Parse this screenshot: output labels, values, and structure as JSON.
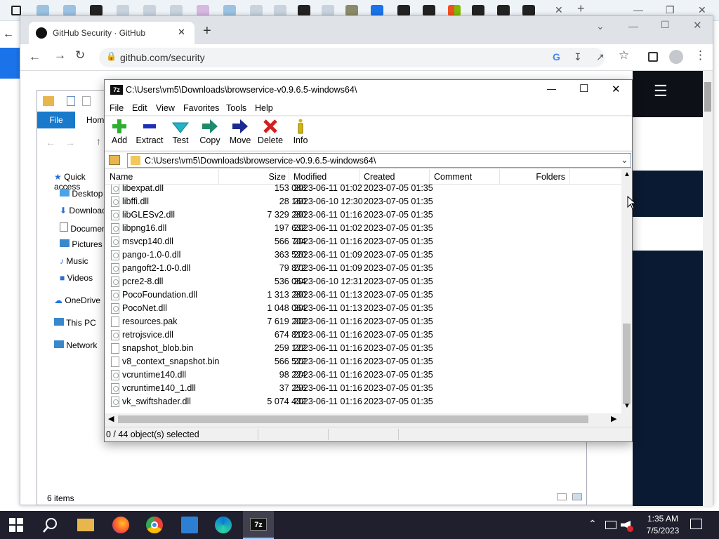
{
  "outer_window": {
    "minimize_glyph": "—",
    "maximize_glyph": "❐",
    "close_glyph": "✕",
    "new_tab_glyph": "+"
  },
  "chrome": {
    "tab_title": "GitHub Security · GitHub",
    "tab_close_glyph": "✕",
    "new_tab_glyph": "+",
    "url": "github.com/security",
    "menu_glyph": "⋮",
    "hamburger_glyph": "☰",
    "colors": {
      "site_dark": "#0b1a33"
    }
  },
  "explorer": {
    "file_tab": "File",
    "home_tab": "Home",
    "nav_items": [
      {
        "label": "Quick access",
        "icon": "star-icon"
      },
      {
        "label": "Desktop",
        "icon": "desktop-folder-icon"
      },
      {
        "label": "Downloads",
        "icon": "downloads-folder-icon"
      },
      {
        "label": "Documents",
        "icon": "documents-folder-icon"
      },
      {
        "label": "Pictures",
        "icon": "pictures-folder-icon"
      },
      {
        "label": "Music",
        "icon": "music-folder-icon"
      },
      {
        "label": "Videos",
        "icon": "videos-folder-icon"
      },
      {
        "label": "OneDrive",
        "icon": "onedrive-icon"
      },
      {
        "label": "This PC",
        "icon": "this-pc-icon"
      },
      {
        "label": "Network",
        "icon": "network-icon"
      }
    ],
    "status": "6 items"
  },
  "zip": {
    "app_icon_label": "7z",
    "title": "C:\\Users\\vm5\\Downloads\\browservice-v0.9.6.5-windows64\\",
    "minimize_glyph": "—",
    "maximize_glyph": "☐",
    "close_glyph": "✕",
    "menu": [
      "File",
      "Edit",
      "View",
      "Favorites",
      "Tools",
      "Help"
    ],
    "toolbar": [
      {
        "label": "Add",
        "icon": "add-plus-icon",
        "color": "#2fae2f"
      },
      {
        "label": "Extract",
        "icon": "extract-minus-icon",
        "color": "#1c2fb8"
      },
      {
        "label": "Test",
        "icon": "test-check-icon",
        "color": "#22b3c8"
      },
      {
        "label": "Copy",
        "icon": "copy-arrow-icon",
        "color": "#1f8a6c"
      },
      {
        "label": "Move",
        "icon": "move-arrow-icon",
        "color": "#1b2a8f"
      },
      {
        "label": "Delete",
        "icon": "delete-x-icon",
        "color": "#d41f1f"
      },
      {
        "label": "Info",
        "icon": "info-i-icon",
        "color": "#d4b400"
      }
    ],
    "address": "C:\\Users\\vm5\\Downloads\\browservice-v0.9.6.5-windows64\\",
    "columns": [
      "Name",
      "Size",
      "Modified",
      "Created",
      "Comment",
      "Folders"
    ],
    "rows": [
      {
        "name": "libexpat.dll",
        "size": "153 088",
        "modified": "2023-06-11 01:02",
        "created": "2023-07-05 01:35",
        "type": "dll"
      },
      {
        "name": "libffi.dll",
        "size": "28 160",
        "modified": "2023-06-10 12:30",
        "created": "2023-07-05 01:35",
        "type": "dll"
      },
      {
        "name": "libGLESv2.dll",
        "size": "7 329 280",
        "modified": "2023-06-11 01:16",
        "created": "2023-07-05 01:35",
        "type": "dll"
      },
      {
        "name": "libpng16.dll",
        "size": "197 632",
        "modified": "2023-06-11 01:02",
        "created": "2023-07-05 01:35",
        "type": "dll"
      },
      {
        "name": "msvcp140.dll",
        "size": "566 704",
        "modified": "2023-06-11 01:16",
        "created": "2023-07-05 01:35",
        "type": "dll"
      },
      {
        "name": "pango-1.0-0.dll",
        "size": "363 520",
        "modified": "2023-06-11 01:09",
        "created": "2023-07-05 01:35",
        "type": "dll"
      },
      {
        "name": "pangoft2-1.0-0.dll",
        "size": "79 872",
        "modified": "2023-06-11 01:09",
        "created": "2023-07-05 01:35",
        "type": "dll"
      },
      {
        "name": "pcre2-8.dll",
        "size": "536 064",
        "modified": "2023-06-10 12:31",
        "created": "2023-07-05 01:35",
        "type": "dll"
      },
      {
        "name": "PocoFoundation.dll",
        "size": "1 313 280",
        "modified": "2023-06-11 01:13",
        "created": "2023-07-05 01:35",
        "type": "dll"
      },
      {
        "name": "PocoNet.dll",
        "size": "1 048 064",
        "modified": "2023-06-11 01:13",
        "created": "2023-07-05 01:35",
        "type": "dll"
      },
      {
        "name": "resources.pak",
        "size": "7 619 202",
        "modified": "2023-06-11 01:16",
        "created": "2023-07-05 01:35",
        "type": "file"
      },
      {
        "name": "retrojsvice.dll",
        "size": "674 816",
        "modified": "2023-06-11 01:16",
        "created": "2023-07-05 01:35",
        "type": "dll"
      },
      {
        "name": "snapshot_blob.bin",
        "size": "259 122",
        "modified": "2023-06-11 01:16",
        "created": "2023-07-05 01:35",
        "type": "file"
      },
      {
        "name": "v8_context_snapshot.bin",
        "size": "566 522",
        "modified": "2023-06-11 01:16",
        "created": "2023-07-05 01:35",
        "type": "file"
      },
      {
        "name": "vcruntime140.dll",
        "size": "98 224",
        "modified": "2023-06-11 01:16",
        "created": "2023-07-05 01:35",
        "type": "dll"
      },
      {
        "name": "vcruntime140_1.dll",
        "size": "37 256",
        "modified": "2023-06-11 01:16",
        "created": "2023-07-05 01:35",
        "type": "dll"
      },
      {
        "name": "vk_swiftshader.dll",
        "size": "5 074 432",
        "modified": "2023-06-11 01:16",
        "created": "2023-07-05 01:35",
        "type": "dll"
      }
    ],
    "status": "0 / 44 object(s) selected"
  },
  "taskbar": {
    "time": "1:35 AM",
    "date": "7/5/2023",
    "apps": [
      "start-icon",
      "search-icon",
      "file-explorer-icon",
      "firefox-icon",
      "chrome-icon",
      "store-icon",
      "edge-icon",
      "7zip-icon"
    ]
  }
}
